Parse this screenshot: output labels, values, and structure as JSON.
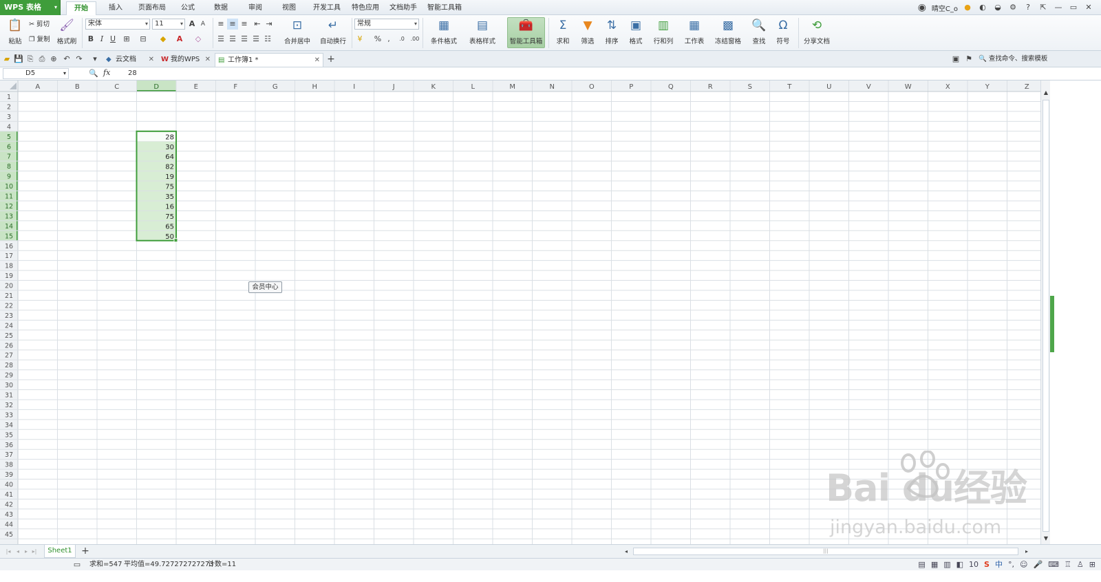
{
  "app": {
    "name": "WPS 表格"
  },
  "ribbon_tabs": [
    "开始",
    "插入",
    "页面布局",
    "公式",
    "数据",
    "审阅",
    "视图",
    "开发工具",
    "特色应用",
    "文档助手",
    "智能工具箱"
  ],
  "active_ribbon_tab": "开始",
  "user": {
    "name": "晴空C_o"
  },
  "ribbon": {
    "paste": "粘贴",
    "cut": "剪切",
    "copy": "复制",
    "format_painter": "格式刷",
    "font_name": "宋体",
    "font_size": "11",
    "merge_center": "合并居中",
    "wrap_text": "自动换行",
    "number_format": "常规",
    "cond_format": "条件格式",
    "table_style": "表格样式",
    "smart_toolbox": "智能工具箱",
    "sum": "求和",
    "filter": "筛选",
    "sort": "排序",
    "format": "格式",
    "row_col": "行和列",
    "worksheet": "工作表",
    "freeze": "冻结窗格",
    "find": "查找",
    "symbol": "符号",
    "share": "分享文档"
  },
  "doc_tabs": [
    {
      "label": "云文档"
    },
    {
      "label": "我的WPS"
    },
    {
      "label": "工作簿1 *"
    }
  ],
  "search_label": "查找命令、搜索模板",
  "formula_bar": {
    "cell_ref": "D5",
    "fx": "fx",
    "value": "28"
  },
  "columns": [
    "A",
    "B",
    "C",
    "D",
    "E",
    "F",
    "G",
    "H",
    "I",
    "J",
    "K",
    "L",
    "M",
    "N",
    "O",
    "P",
    "Q",
    "R",
    "S",
    "T",
    "U",
    "V",
    "W",
    "X",
    "Y",
    "Z"
  ],
  "row_count": 45,
  "selected_column": "D",
  "selection": {
    "first_row": 5,
    "last_row": 15
  },
  "cells": [
    {
      "col": "D",
      "row": 5,
      "value": "28"
    },
    {
      "col": "D",
      "row": 6,
      "value": "30"
    },
    {
      "col": "D",
      "row": 7,
      "value": "64"
    },
    {
      "col": "D",
      "row": 8,
      "value": "82"
    },
    {
      "col": "D",
      "row": 9,
      "value": "19"
    },
    {
      "col": "D",
      "row": 10,
      "value": "75"
    },
    {
      "col": "D",
      "row": 11,
      "value": "35"
    },
    {
      "col": "D",
      "row": 12,
      "value": "16"
    },
    {
      "col": "D",
      "row": 13,
      "value": "75"
    },
    {
      "col": "D",
      "row": 14,
      "value": "65"
    },
    {
      "col": "D",
      "row": 15,
      "value": "50"
    }
  ],
  "tooltip": "会员中心",
  "sheet_tab": "Sheet1",
  "status": {
    "sum": "求和=547",
    "average": "平均值=49.727272727273",
    "count": "计数=11"
  },
  "zoom_prefix": "10",
  "watermark": {
    "logo": "Bai du经验",
    "url": "jingyan.baidu.com"
  },
  "colors": {
    "accent_green": "#3f9d3b",
    "selection_fill": "#d8edd4",
    "selection_border": "#3f9d3b"
  }
}
